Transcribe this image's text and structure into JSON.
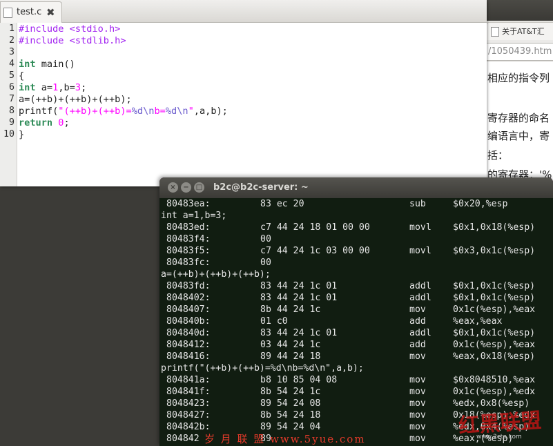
{
  "browser": {
    "tab_label": "关于AT&T汇",
    "url": "/1050439.htm",
    "lines": [
      "相应的指令列",
      "寄存器的命名",
      "编语言中，寄",
      "括：",
      "的寄存器：'%"
    ]
  },
  "editor": {
    "tab_name": "test.c",
    "close_glyph": "✖",
    "line_numbers": [
      "1",
      "2",
      "3",
      "4",
      "5",
      "6",
      "7",
      "8",
      "9",
      "10"
    ],
    "lines": [
      [
        {
          "t": "#include <stdio.h>",
          "c": "pre"
        }
      ],
      [
        {
          "t": "#include <stdlib.h>",
          "c": "pre"
        }
      ],
      [],
      [
        {
          "t": "int",
          "c": "kw"
        },
        {
          "t": " main()",
          "c": ""
        }
      ],
      [
        {
          "t": "{",
          "c": ""
        }
      ],
      [
        {
          "t": "int",
          "c": "kw"
        },
        {
          "t": " a=",
          "c": ""
        },
        {
          "t": "1",
          "c": "num"
        },
        {
          "t": ",b=",
          "c": ""
        },
        {
          "t": "3",
          "c": "num"
        },
        {
          "t": ";",
          "c": ""
        }
      ],
      [
        {
          "t": "a=(++b)+(++b)+(++b);",
          "c": ""
        }
      ],
      [
        {
          "t": "printf(",
          "c": ""
        },
        {
          "t": "\"(++b)+(++b)=",
          "c": "str"
        },
        {
          "t": "%d",
          "c": "esc"
        },
        {
          "t": "\\n",
          "c": "esc"
        },
        {
          "t": "b=",
          "c": "str"
        },
        {
          "t": "%d",
          "c": "esc"
        },
        {
          "t": "\\n",
          "c": "esc"
        },
        {
          "t": "\"",
          "c": "str"
        },
        {
          "t": ",a,b);",
          "c": ""
        }
      ],
      [
        {
          "t": "return",
          "c": "kw"
        },
        {
          "t": " ",
          "c": ""
        },
        {
          "t": "0",
          "c": "num"
        },
        {
          "t": ";",
          "c": ""
        }
      ],
      [
        {
          "t": "}",
          "c": ""
        }
      ]
    ]
  },
  "terminal": {
    "title": "b2c@b2c-server: ~",
    "close_glyph": "×",
    "min_glyph": "−",
    "max_glyph": "□",
    "lines": [
      {
        "addr": "80483ea:",
        "hex": "83 ec 20",
        "mn": "sub",
        "ops": "$0x20,%esp"
      },
      {
        "src": "int a=1,b=3;"
      },
      {
        "addr": "80483ed:",
        "hex": "c7 44 24 18 01 00 00",
        "mn": "movl",
        "ops": "$0x1,0x18(%esp)"
      },
      {
        "addr": "80483f4:",
        "hex": "00"
      },
      {
        "addr": "80483f5:",
        "hex": "c7 44 24 1c 03 00 00",
        "mn": "movl",
        "ops": "$0x3,0x1c(%esp)"
      },
      {
        "addr": "80483fc:",
        "hex": "00"
      },
      {
        "src": "a=(++b)+(++b)+(++b);"
      },
      {
        "addr": "80483fd:",
        "hex": "83 44 24 1c 01",
        "mn": "addl",
        "ops": "$0x1,0x1c(%esp)"
      },
      {
        "addr": "8048402:",
        "hex": "83 44 24 1c 01",
        "mn": "addl",
        "ops": "$0x1,0x1c(%esp)"
      },
      {
        "addr": "8048407:",
        "hex": "8b 44 24 1c",
        "mn": "mov",
        "ops": "0x1c(%esp),%eax"
      },
      {
        "addr": "804840b:",
        "hex": "01 c0",
        "mn": "add",
        "ops": "%eax,%eax"
      },
      {
        "addr": "804840d:",
        "hex": "83 44 24 1c 01",
        "mn": "addl",
        "ops": "$0x1,0x1c(%esp)"
      },
      {
        "addr": "8048412:",
        "hex": "03 44 24 1c",
        "mn": "add",
        "ops": "0x1c(%esp),%eax"
      },
      {
        "addr": "8048416:",
        "hex": "89 44 24 18",
        "mn": "mov",
        "ops": "%eax,0x18(%esp)"
      },
      {
        "src": "printf(\"(++b)+(++b)=%d\\nb=%d\\n\",a,b);"
      },
      {
        "addr": "804841a:",
        "hex": "b8 10 85 04 08",
        "mn": "mov",
        "ops": "$0x8048510,%eax"
      },
      {
        "addr": "804841f:",
        "hex": "8b 54 24 1c",
        "mn": "mov",
        "ops": "0x1c(%esp),%edx"
      },
      {
        "addr": "8048423:",
        "hex": "89 54 24 08",
        "mn": "mov",
        "ops": "%edx,0x8(%esp)"
      },
      {
        "addr": "8048427:",
        "hex": "8b 54 24 18",
        "mn": "mov",
        "ops": "0x18(%esp),%edx"
      },
      {
        "addr": "804842b:",
        "hex": "89 54 24 04",
        "mn": "mov",
        "ops": "%edx,0x4(%esp)"
      },
      {
        "addr": "804842",
        "hex": "89 ",
        "mn": "mov",
        "ops": "%eax,(%esp)"
      }
    ]
  },
  "watermarks": {
    "site_cn": "岁 月 联 盟 www.5yue.com",
    "brand": "红黑联盟",
    "brand_url": "www.2cto.com"
  },
  "colors": {
    "preprocessor": "#a020f0",
    "keyword": "#2e8b57",
    "number_string": "#ff00ff",
    "terminal_bg": "#111d11",
    "terminal_fg": "#e6e6e6"
  }
}
